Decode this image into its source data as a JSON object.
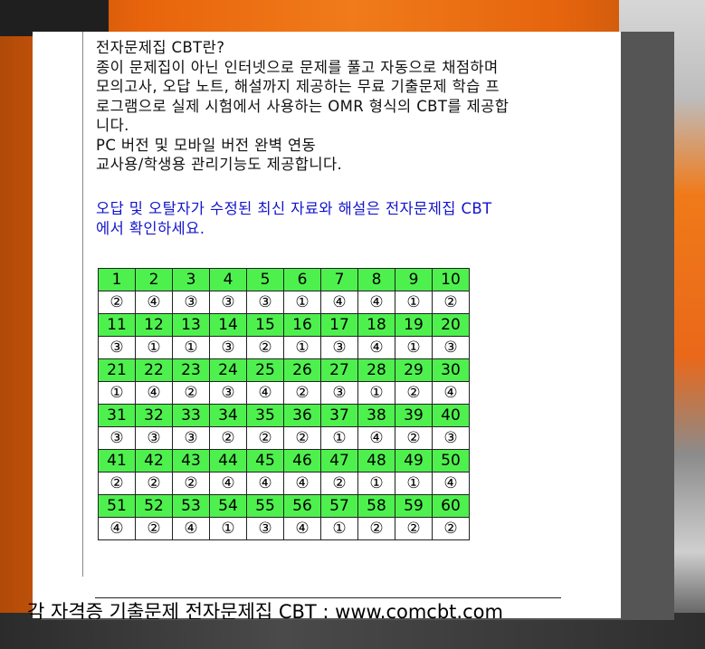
{
  "intro": {
    "title": "전자문제집 CBT란?",
    "line1": "종이 문제집이 아닌 인터넷으로 문제를 풀고 자동으로 채점하며",
    "line2": "모의고사, 오답 노트, 해설까지 제공하는 무료 기출문제 학습 프",
    "line3": "로그램으로 실제 시험에서 사용하는 OMR 형식의 CBT를 제공합",
    "line4": "니다.",
    "line5": "PC 버전 및 모바일 버전 완벽 연동",
    "line6": "교사용/학생용 관리기능도 제공합니다."
  },
  "notice": {
    "line1": "오답 및 오탈자가 수정된 최신 자료와 해설은 전자문제집 CBT",
    "line2": "에서 확인하세요."
  },
  "answer_table": {
    "rows": [
      {
        "numbers": [
          "1",
          "2",
          "3",
          "4",
          "5",
          "6",
          "7",
          "8",
          "9",
          "10"
        ],
        "answers": [
          "②",
          "④",
          "③",
          "③",
          "③",
          "①",
          "④",
          "④",
          "①",
          "②"
        ]
      },
      {
        "numbers": [
          "11",
          "12",
          "13",
          "14",
          "15",
          "16",
          "17",
          "18",
          "19",
          "20"
        ],
        "answers": [
          "③",
          "①",
          "①",
          "③",
          "②",
          "①",
          "③",
          "④",
          "①",
          "③"
        ]
      },
      {
        "numbers": [
          "21",
          "22",
          "23",
          "24",
          "25",
          "26",
          "27",
          "28",
          "29",
          "30"
        ],
        "answers": [
          "①",
          "④",
          "②",
          "③",
          "④",
          "②",
          "③",
          "①",
          "②",
          "④"
        ]
      },
      {
        "numbers": [
          "31",
          "32",
          "33",
          "34",
          "35",
          "36",
          "37",
          "38",
          "39",
          "40"
        ],
        "answers": [
          "③",
          "③",
          "③",
          "②",
          "②",
          "②",
          "①",
          "④",
          "②",
          "③"
        ]
      },
      {
        "numbers": [
          "41",
          "42",
          "43",
          "44",
          "45",
          "46",
          "47",
          "48",
          "49",
          "50"
        ],
        "answers": [
          "②",
          "②",
          "②",
          "④",
          "④",
          "④",
          "②",
          "①",
          "①",
          "④"
        ]
      },
      {
        "numbers": [
          "51",
          "52",
          "53",
          "54",
          "55",
          "56",
          "57",
          "58",
          "59",
          "60"
        ],
        "answers": [
          "④",
          "②",
          "④",
          "①",
          "③",
          "④",
          "①",
          "②",
          "②",
          "②"
        ]
      }
    ]
  },
  "footer": {
    "text": "각 자격증 기출문제 전자문제집 CBT : www.comcbt.com"
  },
  "colors": {
    "number_cell_bg": "#4ef04e",
    "notice_text": "#1414cc"
  }
}
